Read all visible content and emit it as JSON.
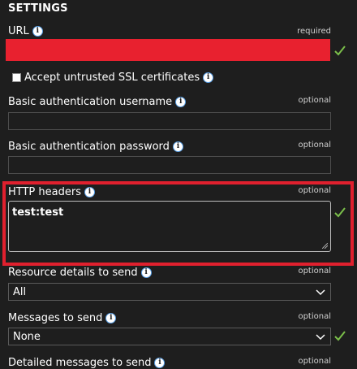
{
  "section_title": "SETTINGS",
  "url": {
    "label": "URL",
    "tag": "required"
  },
  "accept_ssl": {
    "label": "Accept untrusted SSL certificates",
    "checked": false
  },
  "basic_user": {
    "label": "Basic authentication username",
    "tag": "optional",
    "value": ""
  },
  "basic_pass": {
    "label": "Basic authentication password",
    "tag": "optional",
    "value": ""
  },
  "http_headers": {
    "label": "HTTP headers",
    "tag": "optional",
    "value": "test:test"
  },
  "resource_details": {
    "label": "Resource details to send",
    "tag": "optional",
    "selected": "All"
  },
  "messages": {
    "label": "Messages to send",
    "tag": "optional",
    "selected": "None"
  },
  "detailed_messages": {
    "label": "Detailed messages to send",
    "tag": "optional"
  },
  "colors": {
    "background": "#1e1e1e",
    "redaction": "#e8212f",
    "highlight": "#e0202e",
    "check": "#7bbf4a"
  },
  "icons": {
    "info": "info-icon",
    "valid": "checkmark-icon",
    "dropdown": "chevron-down-icon"
  }
}
